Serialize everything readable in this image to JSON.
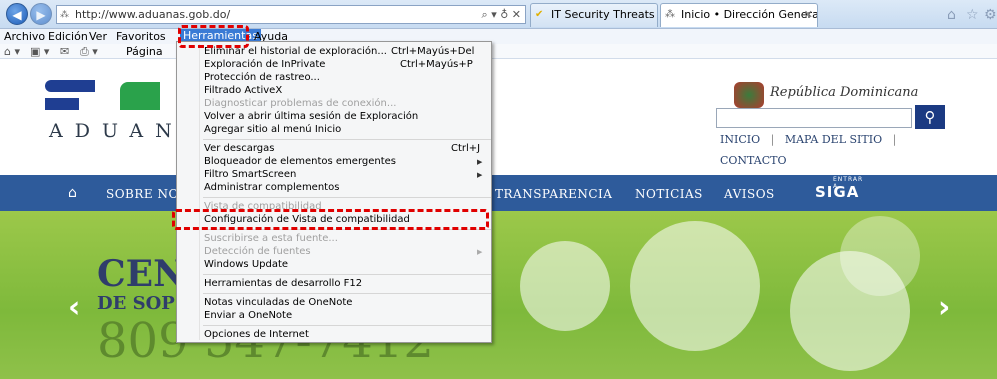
{
  "browser": {
    "address": "http://www.aduanas.gob.do/",
    "address_tools": "⌕ ▾ ♁ ✕",
    "tabs": [
      {
        "label": "IT Security Threats | Symantec"
      },
      {
        "label": "Inicio • Dirección General d..."
      }
    ],
    "close_glyph": "✕",
    "menubar": [
      "Archivo",
      "Edición",
      "Ver",
      "Favoritos",
      "Herramientas",
      "Ayuda"
    ],
    "cmdbar": {
      "page_label": "Página"
    }
  },
  "menu": {
    "items": [
      {
        "label": "Eliminar el historial de exploración...",
        "shortcut": "Ctrl+Mayús+Del",
        "disabled": false
      },
      {
        "label": "Exploración de InPrivate",
        "shortcut": "Ctrl+Mayús+P",
        "disabled": false
      },
      {
        "label": "Protección de rastreo...",
        "shortcut": "",
        "disabled": false
      },
      {
        "label": "Filtrado ActiveX",
        "shortcut": "",
        "disabled": false
      },
      {
        "label": "Diagnosticar problemas de conexión...",
        "shortcut": "",
        "disabled": true
      },
      {
        "label": "Volver a abrir última sesión de Exploración",
        "shortcut": "",
        "disabled": false
      },
      {
        "label": "Agregar sitio al menú Inicio",
        "shortcut": "",
        "disabled": false
      },
      {
        "label": "Ver descargas",
        "shortcut": "Ctrl+J",
        "disabled": false
      },
      {
        "label": "Bloqueador de elementos emergentes",
        "shortcut": "",
        "disabled": false,
        "submenu": true
      },
      {
        "label": "Filtro SmartScreen",
        "shortcut": "",
        "disabled": false,
        "submenu": true
      },
      {
        "label": "Administrar complementos",
        "shortcut": "",
        "disabled": false
      },
      {
        "label": "Vista de compatibilidad",
        "shortcut": "",
        "disabled": true
      },
      {
        "label": "Configuración de Vista de compatibilidad",
        "shortcut": "",
        "disabled": false
      },
      {
        "label": "Suscribirse a esta fuente...",
        "shortcut": "",
        "disabled": true
      },
      {
        "label": "Detección de fuentes",
        "shortcut": "",
        "disabled": true,
        "submenu": true
      },
      {
        "label": "Windows Update",
        "shortcut": "",
        "disabled": false
      },
      {
        "label": "Herramientas de desarrollo F12",
        "shortcut": "",
        "disabled": false
      },
      {
        "label": "Notas vinculadas de OneNote",
        "shortcut": "",
        "disabled": false
      },
      {
        "label": "Enviar a OneNote",
        "shortcut": "",
        "disabled": false
      },
      {
        "label": "Opciones de Internet",
        "shortcut": "",
        "disabled": false
      }
    ]
  },
  "site": {
    "logo_text": "ADUANAS",
    "republica": "República Dominicana",
    "links": {
      "inicio": "INICIO",
      "mapa": "MAPA DEL SITIO",
      "contacto": "CONTACTO"
    },
    "nav": {
      "sobre": "SOBRE NO",
      "transparencia": "TRANSPARENCIA",
      "noticias": "NOTICIAS",
      "avisos": "AVISOS",
      "siga": "SIGA",
      "siga_small": "ENTRAR A"
    },
    "banner": {
      "line1": "CEN",
      "line2": "DE SOP",
      "phone": "809 547-7412"
    }
  },
  "colors": {
    "nav_blue": "#2e5b9b",
    "banner_green": "#8fc14a",
    "highlight": "#e00000"
  }
}
